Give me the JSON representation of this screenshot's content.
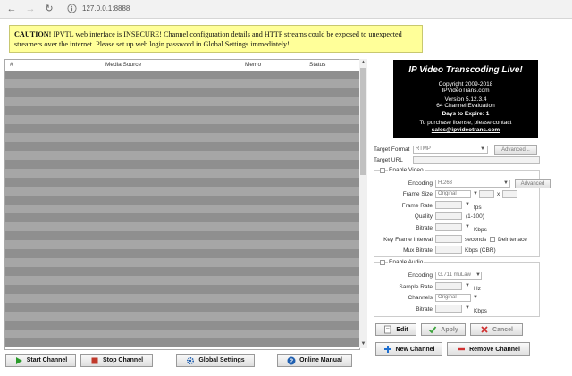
{
  "browser": {
    "url": "127.0.0.1:8888"
  },
  "caution": {
    "bold": "CAUTION!",
    "text": " IPVTL web interface is INSECURE! Channel configuration details and HTTP streams could be exposed to unexpected streamers over the internet. Please set up web login password in Global Settings immediately!"
  },
  "table": {
    "columns": [
      "#",
      "Media Source",
      "Memo",
      "Status"
    ]
  },
  "buttons": {
    "start_channel": "Start Channel",
    "stop_channel": "Stop Channel",
    "global_settings": "Global Settings",
    "online_manual": "Online Manual",
    "edit": "Edit",
    "apply": "Apply",
    "cancel": "Cancel",
    "new_channel": "New Channel",
    "remove_channel": "Remove Channel",
    "advanced_target": "Advanced...",
    "advanced_video": "Advanced"
  },
  "logo": {
    "title": "IP Video Transcoding Live!",
    "copyright": "Copyright 2009-2018",
    "site": "IPVideoTrans.com",
    "version": "Version 5.12.3.4",
    "edition": "64 Channel Evaluation",
    "expire_label": "Days to Expire: ",
    "expire_value": "1",
    "purchase": "To purchase license, please contact",
    "email": "sales@ipvideotrans.com"
  },
  "form": {
    "target_format_label": "Target Format",
    "target_format_value": "RTMP",
    "target_url_label": "Target URL",
    "enable_video_label": "Enable Video",
    "encoding_label": "Encoding",
    "video_encoding_value": "H.263",
    "frame_size_label": "Frame Size",
    "frame_size_value": "Original",
    "x_sep": "x",
    "frame_rate_label": "Frame Rate",
    "fps_unit": "fps",
    "quality_label": "Quality",
    "quality_range": "(1-100)",
    "bitrate_label": "Bitrate",
    "kbps_unit": "Kbps",
    "key_frame_label": "Key Frame Interval",
    "seconds_unit": "seconds",
    "deinterlace_label": "Deinterlace",
    "mux_bitrate_label": "Mux Bitrate",
    "mux_unit": "Kbps (CBR)",
    "enable_audio_label": "Enable Audio",
    "audio_encoding_value": "G.711 muLaw",
    "sample_rate_label": "Sample Rate",
    "hz_unit": "Hz",
    "channels_label": "Channels",
    "channels_value": "Original",
    "audio_bitrate_label": "Bitrate",
    "audio_kbps_unit": "Kbps"
  },
  "colors": {
    "row_dark": "#8f8f8f",
    "row_light": "#a6a6a6",
    "caution_bg": "#ffff99"
  }
}
